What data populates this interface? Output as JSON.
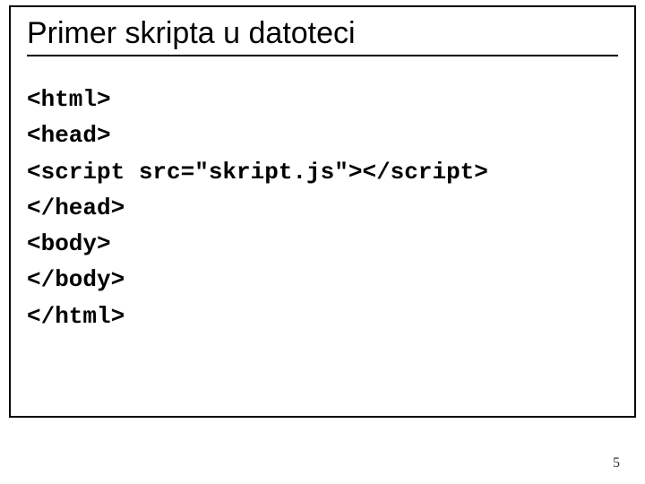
{
  "title": "Primer skripta u datoteci",
  "code_lines": [
    "<html>",
    "<head>",
    "<script src=\"skript.js\"></script>",
    "</head>",
    "<body>",
    "</body>",
    "</html>"
  ],
  "page_number": "5"
}
